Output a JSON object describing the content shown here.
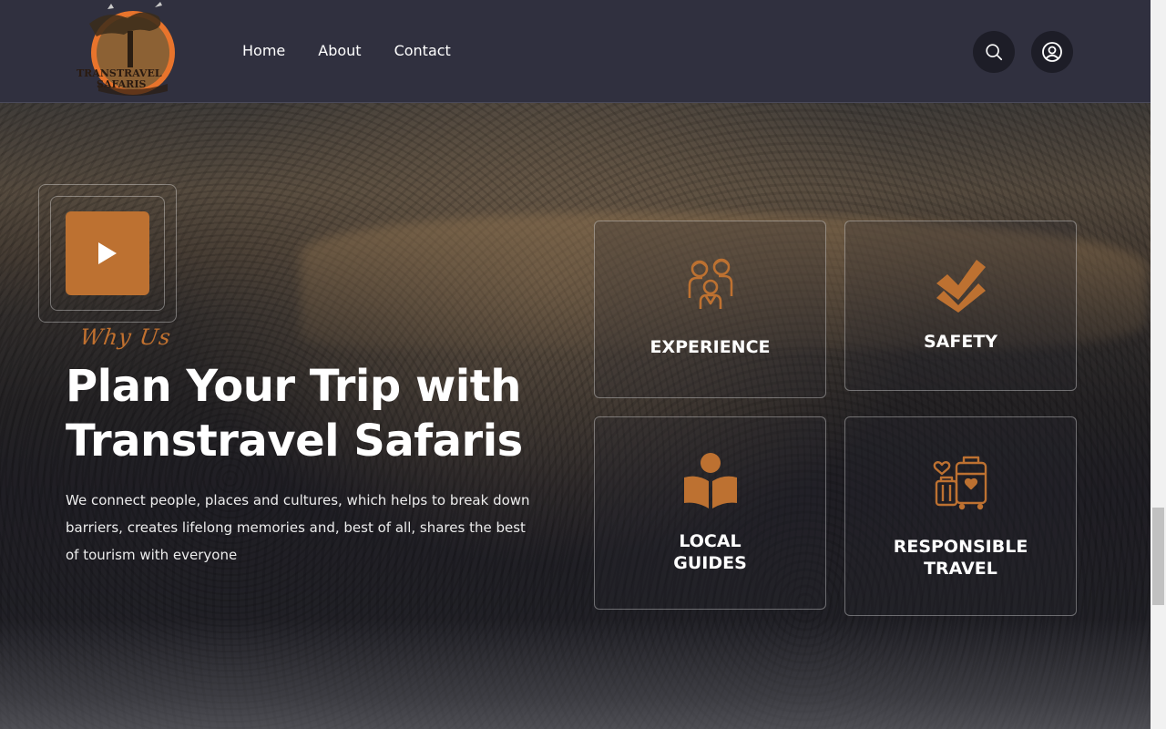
{
  "header": {
    "logo_text_line1": "TRANSTRAVEL",
    "logo_text_line2": "SAFARIS",
    "nav": [
      {
        "label": "Home"
      },
      {
        "label": "About"
      },
      {
        "label": "Contact"
      }
    ],
    "search_icon": "search-icon",
    "user_icon": "user-circle-icon",
    "background_color": "#30303f"
  },
  "hero": {
    "play_icon": "play-icon",
    "script_label": "Why Us",
    "title": "Plan Your Trip with Transtravel Safaris",
    "description": "We connect people, places and cultures, which helps to break down barriers, creates lifelong memories and, best of all, shares the best of tourism with everyone"
  },
  "features": [
    {
      "label": "EXPERIENCE",
      "icon": "people-group-icon"
    },
    {
      "label": "SAFETY",
      "icon": "double-check-icon"
    },
    {
      "label": "LOCAL GUIDES",
      "icon": "reading-person-icon"
    },
    {
      "label": "RESPONSIBLE TRAVEL",
      "icon": "luggage-heart-icon"
    }
  ],
  "colors": {
    "accent": "#bd7131",
    "text": "#ffffff"
  }
}
